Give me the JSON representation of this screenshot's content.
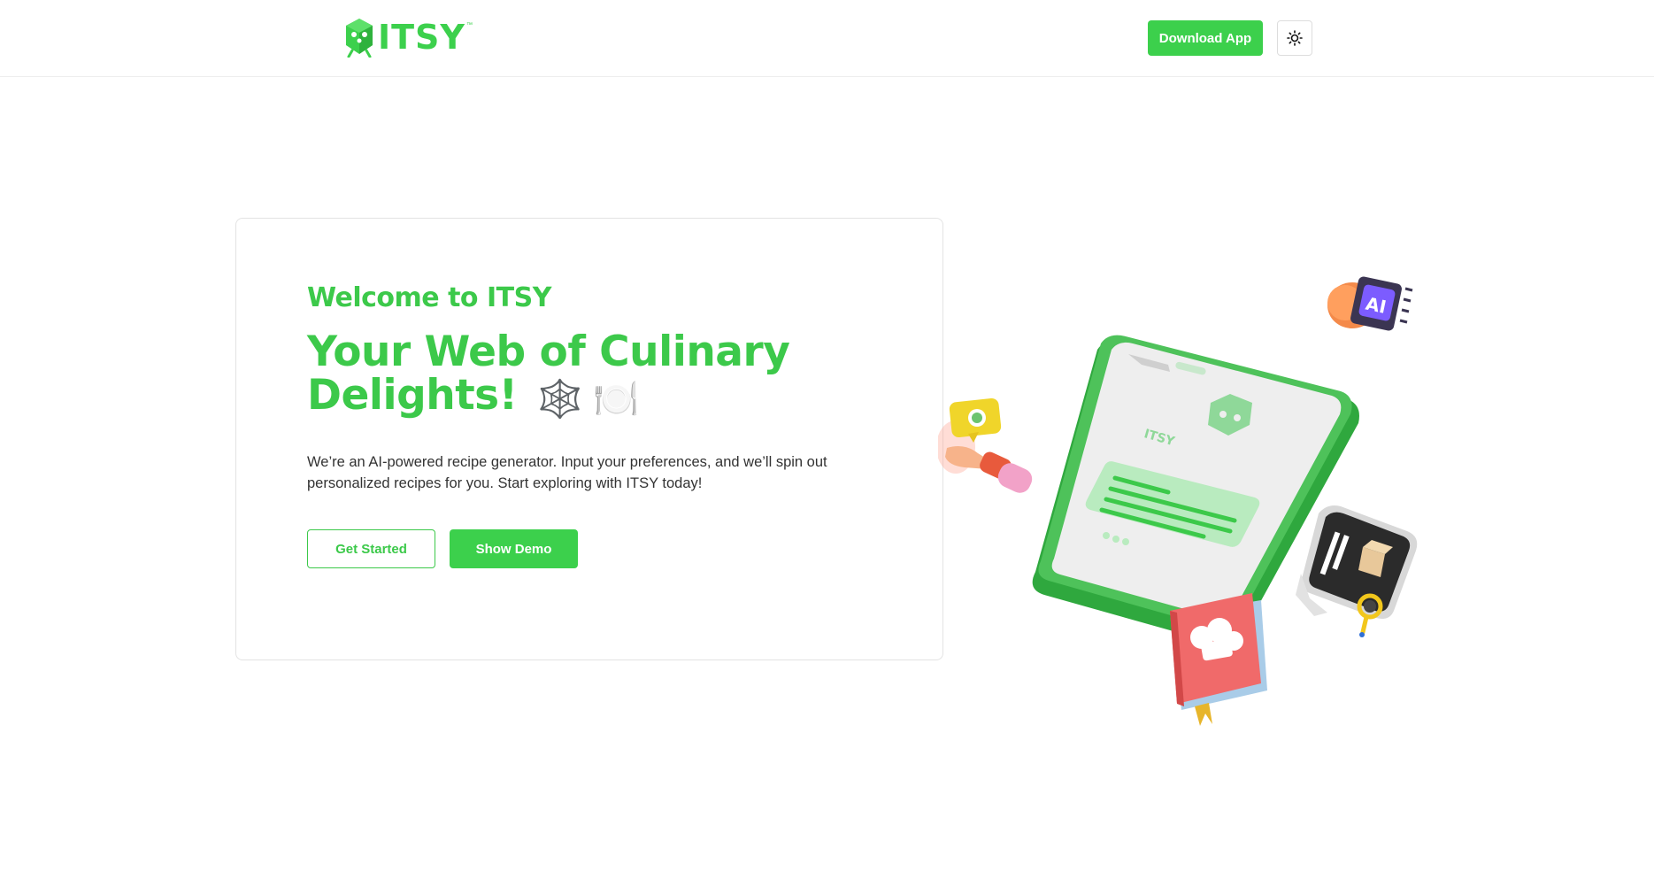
{
  "header": {
    "logo_text": "ITSY",
    "logo_tm": "™",
    "download_label": "Download App",
    "theme_icon": "sun-icon"
  },
  "hero": {
    "welcome": "Welcome to ITSY",
    "headline": "Your Web of Culinary Delights!",
    "headline_emoji_1": "🕸️",
    "headline_emoji_2": "🍽️",
    "description": "We’re an AI-powered recipe generator. Input your preferences, and we’ll spin out personalized recipes for you. Start exploring with ITSY today!",
    "get_started_label": "Get Started",
    "show_demo_label": "Show Demo"
  },
  "illustration": {
    "phone_brand": "ITSY",
    "chip_label": "AI"
  },
  "colors": {
    "brand_green": "#3cd04c",
    "text": "#333333",
    "border": "#e3e3e3"
  }
}
